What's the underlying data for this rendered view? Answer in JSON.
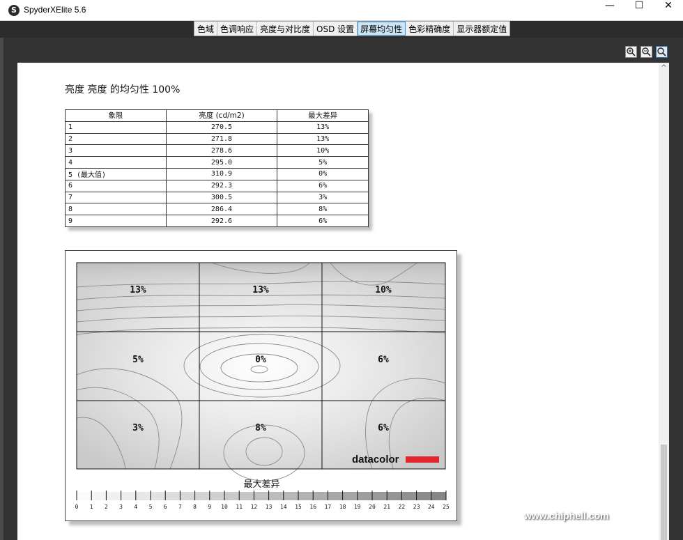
{
  "window": {
    "title": "SpyderXElite 5.6",
    "icon": "S",
    "minimize": "—",
    "maximize": "☐",
    "close": "✕"
  },
  "tabs": [
    {
      "label": "色域",
      "active": false
    },
    {
      "label": "色调响应",
      "active": false
    },
    {
      "label": "亮度与对比度",
      "active": false
    },
    {
      "label": "OSD 设置",
      "active": false
    },
    {
      "label": "屏幕均匀性",
      "active": true
    },
    {
      "label": "色彩精确度",
      "active": false
    },
    {
      "label": "显示器额定值",
      "active": false
    }
  ],
  "zoom": {
    "zoom_in_icon": "zoom-in-icon",
    "zoom_out_icon": "zoom-out-icon",
    "zoom_fit_icon": "zoom-fit-icon"
  },
  "report": {
    "title": "亮度 亮度 的均匀性 100%",
    "table": {
      "headers": [
        "象限",
        "亮度 (cd/m2)",
        "最大差异"
      ],
      "rows": [
        [
          "1",
          "270.5",
          "13%"
        ],
        [
          "2",
          "271.8",
          "13%"
        ],
        [
          "3",
          "278.6",
          "10%"
        ],
        [
          "4",
          "295.0",
          "5%"
        ],
        [
          "5 (最大值)",
          "310.9",
          "0%"
        ],
        [
          "6",
          "292.3",
          "6%"
        ],
        [
          "7",
          "300.5",
          "3%"
        ],
        [
          "8",
          "286.4",
          "8%"
        ],
        [
          "9",
          "292.6",
          "6%"
        ]
      ]
    },
    "map": {
      "cells": [
        "13%",
        "13%",
        "10%",
        "5%",
        "0%",
        "6%",
        "3%",
        "8%",
        "6%"
      ],
      "brand": "datacolor",
      "brand_color": "#e3262e"
    },
    "legend": {
      "title": "最大差异",
      "ticks": [
        "0",
        "1",
        "2",
        "3",
        "4",
        "5",
        "6",
        "7",
        "8",
        "9",
        "10",
        "11",
        "12",
        "13",
        "14",
        "15",
        "16",
        "17",
        "18",
        "19",
        "20",
        "21",
        "22",
        "23",
        "24",
        "25"
      ]
    }
  },
  "watermark": "www.chiphell.com"
}
